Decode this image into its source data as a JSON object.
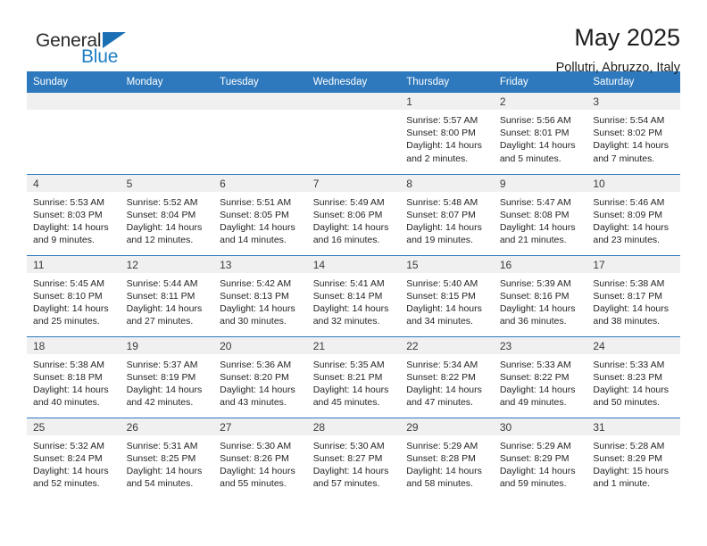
{
  "brand": {
    "name_part1": "General",
    "name_part2": "Blue",
    "logo_icon": "triangle-flag-icon",
    "accent_color": "#1f7ec4"
  },
  "header": {
    "title": "May 2025",
    "subtitle": "Pollutri, Abruzzo, Italy"
  },
  "calendar": {
    "header_bg": "#2e79bd",
    "daynum_bg": "#f0f0f0",
    "weekdays": [
      "Sunday",
      "Monday",
      "Tuesday",
      "Wednesday",
      "Thursday",
      "Friday",
      "Saturday"
    ],
    "weeks": [
      [
        {
          "day": "",
          "lines": []
        },
        {
          "day": "",
          "lines": []
        },
        {
          "day": "",
          "lines": []
        },
        {
          "day": "",
          "lines": []
        },
        {
          "day": "1",
          "lines": [
            "Sunrise: 5:57 AM",
            "Sunset: 8:00 PM",
            "Daylight: 14 hours",
            "and 2 minutes."
          ]
        },
        {
          "day": "2",
          "lines": [
            "Sunrise: 5:56 AM",
            "Sunset: 8:01 PM",
            "Daylight: 14 hours",
            "and 5 minutes."
          ]
        },
        {
          "day": "3",
          "lines": [
            "Sunrise: 5:54 AM",
            "Sunset: 8:02 PM",
            "Daylight: 14 hours",
            "and 7 minutes."
          ]
        }
      ],
      [
        {
          "day": "4",
          "lines": [
            "Sunrise: 5:53 AM",
            "Sunset: 8:03 PM",
            "Daylight: 14 hours",
            "and 9 minutes."
          ]
        },
        {
          "day": "5",
          "lines": [
            "Sunrise: 5:52 AM",
            "Sunset: 8:04 PM",
            "Daylight: 14 hours",
            "and 12 minutes."
          ]
        },
        {
          "day": "6",
          "lines": [
            "Sunrise: 5:51 AM",
            "Sunset: 8:05 PM",
            "Daylight: 14 hours",
            "and 14 minutes."
          ]
        },
        {
          "day": "7",
          "lines": [
            "Sunrise: 5:49 AM",
            "Sunset: 8:06 PM",
            "Daylight: 14 hours",
            "and 16 minutes."
          ]
        },
        {
          "day": "8",
          "lines": [
            "Sunrise: 5:48 AM",
            "Sunset: 8:07 PM",
            "Daylight: 14 hours",
            "and 19 minutes."
          ]
        },
        {
          "day": "9",
          "lines": [
            "Sunrise: 5:47 AM",
            "Sunset: 8:08 PM",
            "Daylight: 14 hours",
            "and 21 minutes."
          ]
        },
        {
          "day": "10",
          "lines": [
            "Sunrise: 5:46 AM",
            "Sunset: 8:09 PM",
            "Daylight: 14 hours",
            "and 23 minutes."
          ]
        }
      ],
      [
        {
          "day": "11",
          "lines": [
            "Sunrise: 5:45 AM",
            "Sunset: 8:10 PM",
            "Daylight: 14 hours",
            "and 25 minutes."
          ]
        },
        {
          "day": "12",
          "lines": [
            "Sunrise: 5:44 AM",
            "Sunset: 8:11 PM",
            "Daylight: 14 hours",
            "and 27 minutes."
          ]
        },
        {
          "day": "13",
          "lines": [
            "Sunrise: 5:42 AM",
            "Sunset: 8:13 PM",
            "Daylight: 14 hours",
            "and 30 minutes."
          ]
        },
        {
          "day": "14",
          "lines": [
            "Sunrise: 5:41 AM",
            "Sunset: 8:14 PM",
            "Daylight: 14 hours",
            "and 32 minutes."
          ]
        },
        {
          "day": "15",
          "lines": [
            "Sunrise: 5:40 AM",
            "Sunset: 8:15 PM",
            "Daylight: 14 hours",
            "and 34 minutes."
          ]
        },
        {
          "day": "16",
          "lines": [
            "Sunrise: 5:39 AM",
            "Sunset: 8:16 PM",
            "Daylight: 14 hours",
            "and 36 minutes."
          ]
        },
        {
          "day": "17",
          "lines": [
            "Sunrise: 5:38 AM",
            "Sunset: 8:17 PM",
            "Daylight: 14 hours",
            "and 38 minutes."
          ]
        }
      ],
      [
        {
          "day": "18",
          "lines": [
            "Sunrise: 5:38 AM",
            "Sunset: 8:18 PM",
            "Daylight: 14 hours",
            "and 40 minutes."
          ]
        },
        {
          "day": "19",
          "lines": [
            "Sunrise: 5:37 AM",
            "Sunset: 8:19 PM",
            "Daylight: 14 hours",
            "and 42 minutes."
          ]
        },
        {
          "day": "20",
          "lines": [
            "Sunrise: 5:36 AM",
            "Sunset: 8:20 PM",
            "Daylight: 14 hours",
            "and 43 minutes."
          ]
        },
        {
          "day": "21",
          "lines": [
            "Sunrise: 5:35 AM",
            "Sunset: 8:21 PM",
            "Daylight: 14 hours",
            "and 45 minutes."
          ]
        },
        {
          "day": "22",
          "lines": [
            "Sunrise: 5:34 AM",
            "Sunset: 8:22 PM",
            "Daylight: 14 hours",
            "and 47 minutes."
          ]
        },
        {
          "day": "23",
          "lines": [
            "Sunrise: 5:33 AM",
            "Sunset: 8:22 PM",
            "Daylight: 14 hours",
            "and 49 minutes."
          ]
        },
        {
          "day": "24",
          "lines": [
            "Sunrise: 5:33 AM",
            "Sunset: 8:23 PM",
            "Daylight: 14 hours",
            "and 50 minutes."
          ]
        }
      ],
      [
        {
          "day": "25",
          "lines": [
            "Sunrise: 5:32 AM",
            "Sunset: 8:24 PM",
            "Daylight: 14 hours",
            "and 52 minutes."
          ]
        },
        {
          "day": "26",
          "lines": [
            "Sunrise: 5:31 AM",
            "Sunset: 8:25 PM",
            "Daylight: 14 hours",
            "and 54 minutes."
          ]
        },
        {
          "day": "27",
          "lines": [
            "Sunrise: 5:30 AM",
            "Sunset: 8:26 PM",
            "Daylight: 14 hours",
            "and 55 minutes."
          ]
        },
        {
          "day": "28",
          "lines": [
            "Sunrise: 5:30 AM",
            "Sunset: 8:27 PM",
            "Daylight: 14 hours",
            "and 57 minutes."
          ]
        },
        {
          "day": "29",
          "lines": [
            "Sunrise: 5:29 AM",
            "Sunset: 8:28 PM",
            "Daylight: 14 hours",
            "and 58 minutes."
          ]
        },
        {
          "day": "30",
          "lines": [
            "Sunrise: 5:29 AM",
            "Sunset: 8:29 PM",
            "Daylight: 14 hours",
            "and 59 minutes."
          ]
        },
        {
          "day": "31",
          "lines": [
            "Sunrise: 5:28 AM",
            "Sunset: 8:29 PM",
            "Daylight: 15 hours",
            "and 1 minute."
          ]
        }
      ]
    ]
  }
}
